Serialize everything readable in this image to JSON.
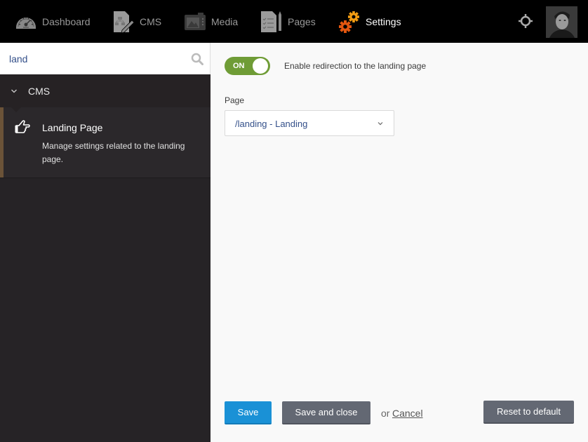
{
  "topbar": {
    "nav": [
      {
        "label": "Dashboard",
        "icon": "speedometer-icon",
        "active": false
      },
      {
        "label": "CMS",
        "icon": "document-edit-icon",
        "active": false
      },
      {
        "label": "Media",
        "icon": "camera-icon",
        "active": false
      },
      {
        "label": "Pages",
        "icon": "checklist-pencil-icon",
        "active": false
      },
      {
        "label": "Settings",
        "icon": "gears-icon",
        "active": true
      }
    ],
    "right_icon": "crosshair-icon",
    "avatar": "user-avatar"
  },
  "sidebar": {
    "search": {
      "value": "land",
      "placeholder": ""
    },
    "group": {
      "label": "CMS",
      "expanded": true
    },
    "entries": [
      {
        "title": "Landing Page",
        "description": "Manage settings related to the landing page.",
        "icon": "hand-pointing-icon"
      }
    ]
  },
  "main": {
    "toggle": {
      "state_label": "ON",
      "on": true,
      "description": "Enable redirection to the landing page"
    },
    "page_field": {
      "label": "Page",
      "selected": "/landing - Landing"
    },
    "actions": {
      "save": "Save",
      "save_close": "Save and close",
      "or": "or",
      "cancel": "Cancel",
      "reset": "Reset to default"
    }
  },
  "colors": {
    "accent_save": "#1a91d6",
    "toggle_on": "#6f9c36",
    "settings_gear_orange": "#f39c12",
    "settings_gear_red": "#e2560f",
    "sidebar_bg": "#262326",
    "sidebar_active_bar": "#6b5338"
  }
}
